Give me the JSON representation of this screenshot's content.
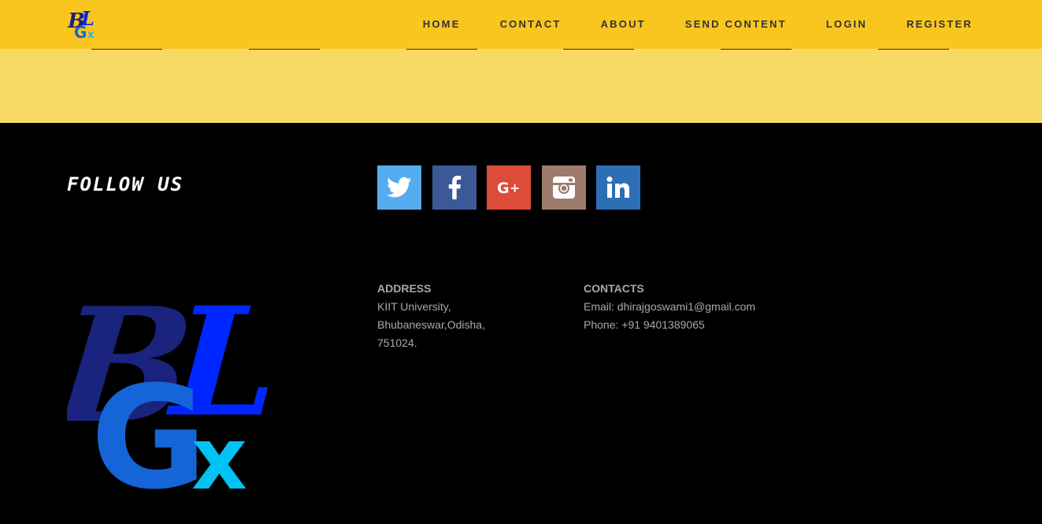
{
  "header": {
    "nav": [
      "HOME",
      "CONTACT",
      "ABOUT",
      "SEND CONTENT",
      "LOGIN",
      "REGISTER"
    ],
    "logo_text": "BLGx"
  },
  "footer": {
    "follow_label": "FOLLOW US",
    "socials": [
      {
        "name": "twitter-icon",
        "color": "#55acee"
      },
      {
        "name": "facebook-icon",
        "color": "#3b5998"
      },
      {
        "name": "google-plus-icon",
        "color": "#dd4b39"
      },
      {
        "name": "instagram-icon",
        "color": "#9c7a6c"
      },
      {
        "name": "linkedin-icon",
        "color": "#2d6eb5"
      }
    ],
    "address": {
      "heading": "ADDRESS",
      "lines": [
        "KIIT University,",
        "Bhubaneswar,Odisha,",
        "751024."
      ]
    },
    "contacts": {
      "heading": "CONTACTS",
      "email": "Email: dhirajgoswami1@gmail.com",
      "phone": "Phone: +91 9401389065"
    }
  },
  "colors": {
    "topbar": "#f9c61f",
    "band": "#f7da63",
    "footer": "#000000",
    "text_muted": "#a9a9a9"
  }
}
